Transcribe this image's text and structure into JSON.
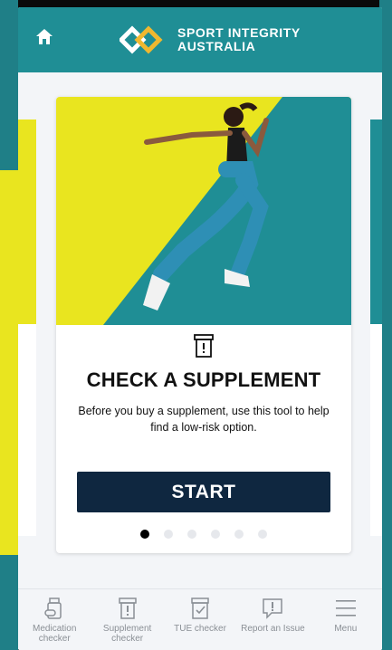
{
  "header": {
    "logo_line1": "SPORT INTEGRITY",
    "logo_line2": "AUSTRALIA",
    "accent_color": "#1f8e95"
  },
  "card": {
    "title": "CHECK A SUPPLEMENT",
    "description": "Before you buy a supplement, use this tool to help find a low-risk option.",
    "button_label": "START",
    "icon": "supplement-jar-icon",
    "carousel": {
      "active_index": 0,
      "total": 6
    }
  },
  "tabs": [
    {
      "label": "Medication checker",
      "icon": "medication-icon"
    },
    {
      "label": "Supplement checker",
      "icon": "supplement-icon"
    },
    {
      "label": "TUE checker",
      "icon": "tue-icon"
    },
    {
      "label": "Report an Issue",
      "icon": "report-icon"
    },
    {
      "label": "Menu",
      "icon": "menu-icon"
    }
  ],
  "colors": {
    "teal": "#1f8e95",
    "yellow": "#e9e51f",
    "navy": "#0f2740"
  }
}
